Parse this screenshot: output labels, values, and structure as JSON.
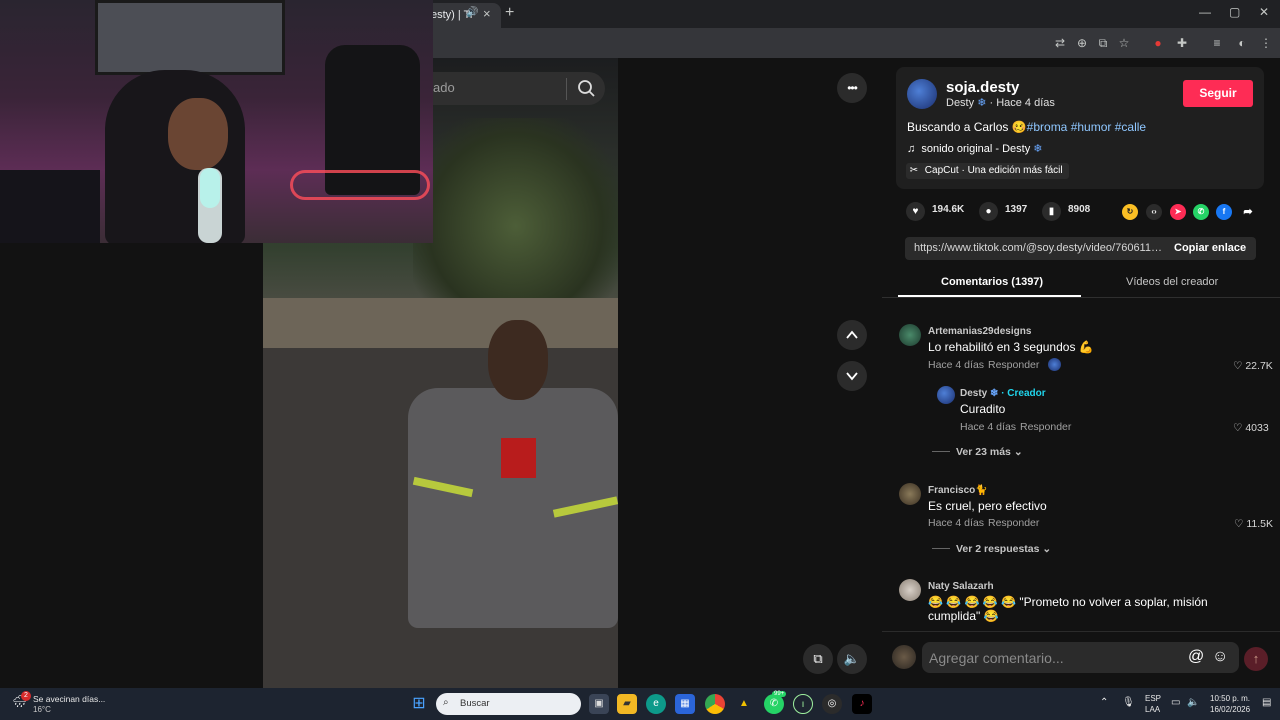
{
  "browser": {
    "tab_title": "esty) | Ti",
    "tab_close": "×",
    "new_tab": "+",
    "window_controls": [
      "—",
      "▢",
      "✕"
    ],
    "toolbar_icons": [
      "translate-icon",
      "zoom-icon",
      "install-icon",
      "bookmark-star-icon",
      "extension-red-icon",
      "extensions-icon",
      "reading-list-icon",
      "profile-icon",
      "menu-icon"
    ]
  },
  "video": {
    "search_placeholder": "ado",
    "more_label": "•••",
    "up_label": "⌃",
    "down_label": "⌄"
  },
  "panel": {
    "username": "soja.desty",
    "display_name": "Desty",
    "posted": "· Hace 4 días",
    "follow_label": "Seguir",
    "desc_text": "Buscando a Carlos 🥴",
    "desc_tags": [
      "#broma",
      "#humor",
      "#calle"
    ],
    "sound": "sonido original - Desty",
    "capcut": "CapCut · Una edición más fácil",
    "likes": "194.6K",
    "comments_count": "1397",
    "saves": "8908",
    "link": "https://www.tiktok.com/@soy.desty/video/7606115...",
    "copy_link": "Copiar enlace",
    "tab_comments": "Comentarios (1397)",
    "tab_videos": "Vídeos del creador"
  },
  "comments": [
    {
      "user": "Artemanias29designs",
      "text": "Lo rehabilitó en 3 segundos 💪",
      "time": "Hace 4 días",
      "reply": "Responder",
      "likes": "22.7K"
    },
    {
      "user": "Desty",
      "creator": "· Creador",
      "text": "Curadito",
      "time": "Hace 4 días",
      "reply": "Responder",
      "likes": "4033"
    },
    {
      "more": "Ver 23 más"
    },
    {
      "user": "Francisco🐈",
      "text": "Es cruel, pero efectivo",
      "time": "Hace 4 días",
      "reply": "Responder",
      "likes": "11.5K"
    },
    {
      "more": "Ver 2 respuestas"
    },
    {
      "user": "Naty Salazarh",
      "text": "😂 😂 😂 😂 😂 \"Prometo no volver a soplar, misión",
      "text2": "cumplida\" 😂"
    }
  ],
  "comment_input": {
    "placeholder": "Agregar comentario...",
    "at": "@",
    "emoji": "☺",
    "send": "↑"
  },
  "taskbar": {
    "weather_text": "Se avecinan días...",
    "weather_temp": "16°C",
    "weather_badge": "2",
    "search_label": "Buscar",
    "lang1": "ESP",
    "lang2": "LAA",
    "time": "10:50 p. m.",
    "date": "16/02/2026",
    "whatsapp_badge": "99+"
  },
  "colors": {
    "accent": "#fe2c55",
    "hashtag": "#8fc7ff",
    "creator": "#20d5ec"
  }
}
